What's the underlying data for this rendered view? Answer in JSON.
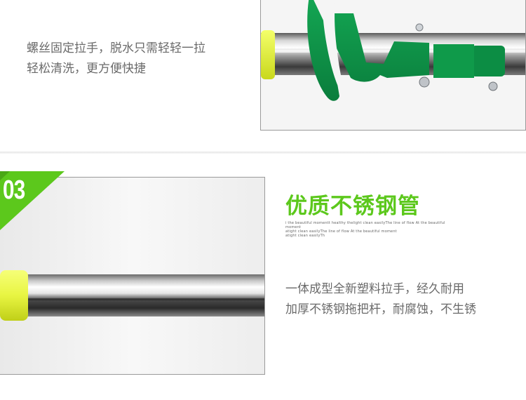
{
  "top": {
    "description_lines": [
      "螺丝固定拉手，脱水只需轻轻一拉",
      "轻松清洗，更方便快捷"
    ]
  },
  "feature": {
    "badge_number": "03",
    "heading": "优质不锈钢管",
    "tiny_text_lines": [
      "i the beautiful momentt healthy thelight clean easilyThe line of flow At the beautiful moment",
      "atight clean easilyThe line of flow At the beautiful moment",
      "atight clean easilyTh"
    ],
    "description_lines": [
      "一体成型全新塑料拉手，经久耐用",
      "加厚不锈钢拖把杆，耐腐蚀，不生锈"
    ]
  },
  "colors": {
    "accent_green": "#5cc81c",
    "handle_green": "#0f9a4a",
    "cap_yellow": "#e8f542"
  }
}
